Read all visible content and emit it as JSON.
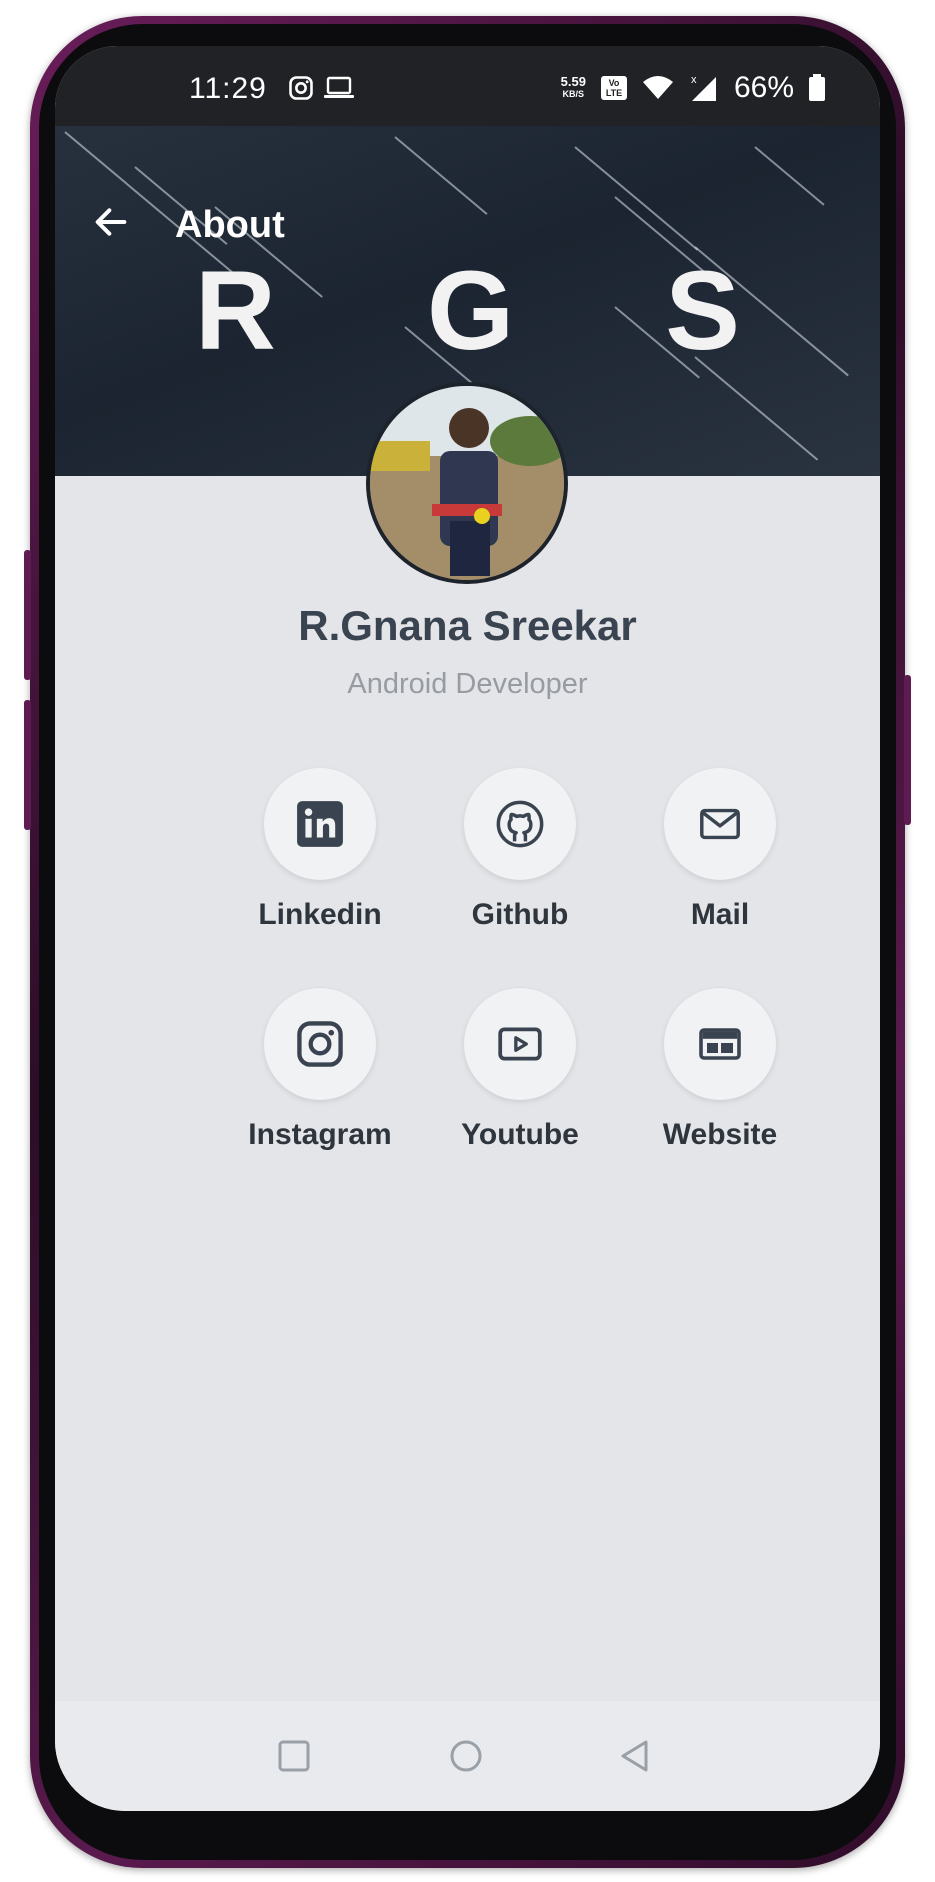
{
  "status_bar": {
    "time": "11:29",
    "net_speed": "5.59",
    "net_speed_unit": "KB/S",
    "volte": "Vo LTE",
    "battery": "66%",
    "icons": [
      "instagram-icon",
      "laptop-icon",
      "volte-icon",
      "wifi-icon",
      "signal-icon",
      "battery-icon"
    ]
  },
  "appbar": {
    "title": "About",
    "back_icon": "arrow-left-icon"
  },
  "banner": {
    "brand_text": "R G S"
  },
  "profile": {
    "name": "R.Gnana Sreekar",
    "role": "Android Developer"
  },
  "links": [
    {
      "label": "Linkedin",
      "icon": "linkedin-icon"
    },
    {
      "label": "Github",
      "icon": "github-icon"
    },
    {
      "label": "Mail",
      "icon": "mail-icon"
    },
    {
      "label": "Instagram",
      "icon": "instagram-icon"
    },
    {
      "label": "Youtube",
      "icon": "youtube-icon"
    },
    {
      "label": "Website",
      "icon": "website-icon"
    }
  ],
  "nav": {
    "recent_icon": "square-icon",
    "home_icon": "circle-icon",
    "back_icon": "triangle-back-icon"
  },
  "colors": {
    "icon": "#3a4350",
    "frame": "#5a1a4e",
    "banner": "#1f2833"
  }
}
